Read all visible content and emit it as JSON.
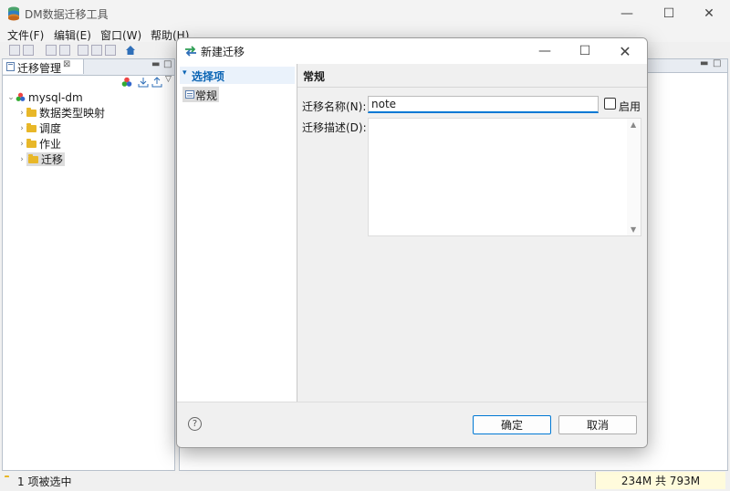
{
  "app": {
    "title": "DM数据迁移工具"
  },
  "menu": {
    "file": "文件(F)",
    "edit": "编辑(E)",
    "window": "窗口(W)",
    "help": "帮助(H)"
  },
  "left_panel": {
    "tab": "迁移管理",
    "tree": {
      "root": "mysql-dm",
      "children": [
        "数据类型映射",
        "调度",
        "作业",
        "迁移"
      ]
    }
  },
  "status": {
    "selection": "1 项被选中",
    "memory": "234M 共 793M"
  },
  "dialog": {
    "title": "新建迁移",
    "nav_header": "选择项",
    "nav_item": "常规",
    "section_title": "常规",
    "name_label": "迁移名称(N):",
    "name_value": "note",
    "enable_label": "启用",
    "desc_label": "迁移描述(D):",
    "ok": "确定",
    "cancel": "取消"
  },
  "colors": {
    "accent": "#0078d4",
    "folder": "#e8b728"
  }
}
